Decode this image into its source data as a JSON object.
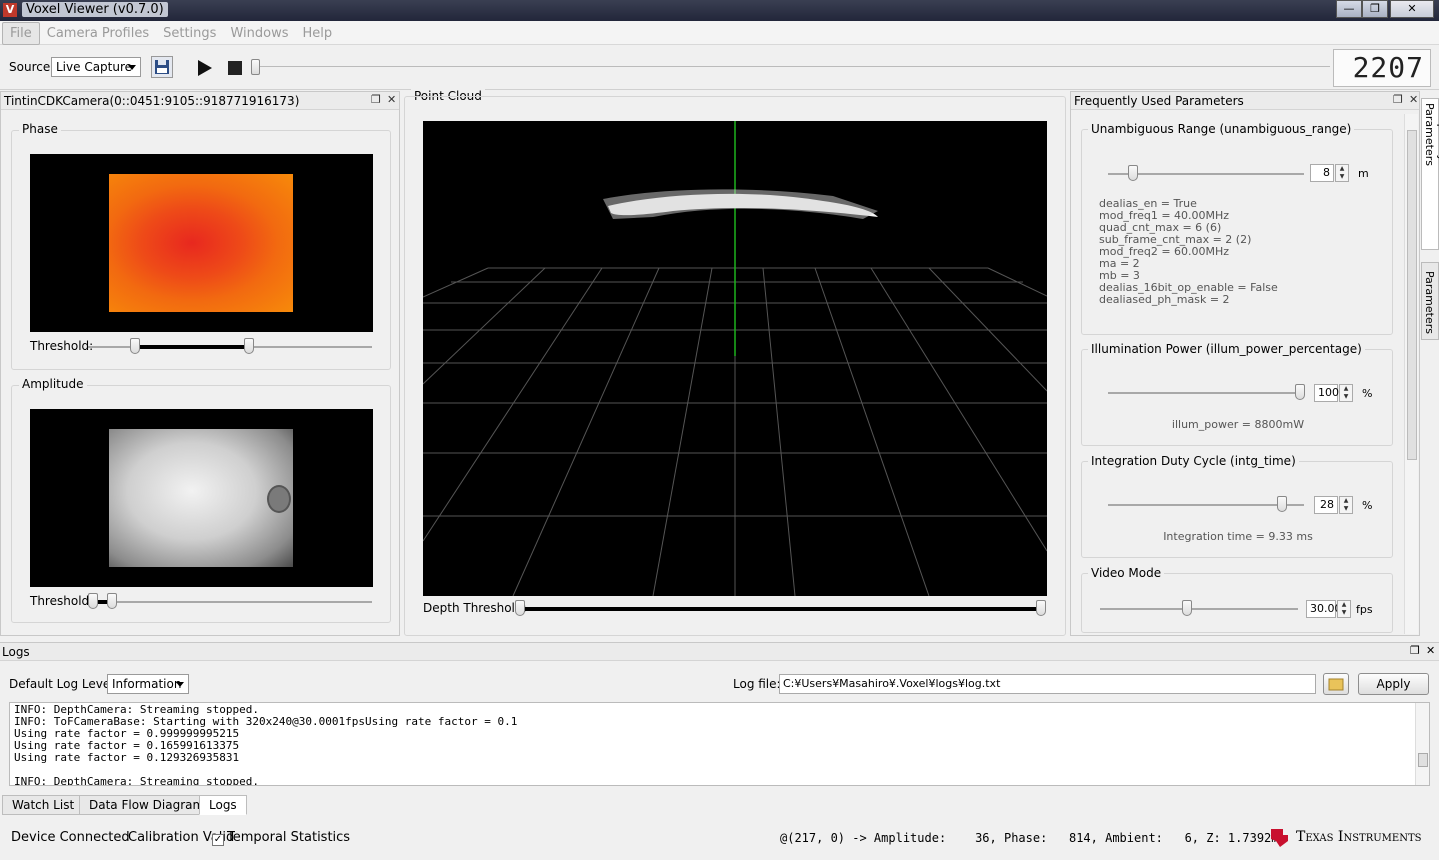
{
  "window": {
    "title": "Voxel Viewer (v0.7.0)",
    "app_icon": "V"
  },
  "menu": [
    "File",
    "Camera Profiles",
    "Settings",
    "Windows",
    "Help"
  ],
  "toolbar": {
    "source_label": "Source:",
    "source_value": "Live Capture",
    "frame_counter": "2207"
  },
  "camera_panel": {
    "title": "TintinCDKCamera(0::0451:9105::918771916173)",
    "phase": {
      "title": "Phase",
      "threshold_label": "Threshold:"
    },
    "amplitude": {
      "title": "Amplitude",
      "threshold_label": "Threshold:"
    }
  },
  "point_cloud": {
    "title": "Point Cloud",
    "depth_threshold_label": "Depth Threshold:"
  },
  "params_panel": {
    "title": "Frequently Used Parameters",
    "unambiguous": {
      "title": "Unambiguous Range (unambiguous_range)",
      "value": "8",
      "unit": "m",
      "details": [
        "dealias_en = True",
        "mod_freq1 = 40.00MHz",
        "quad_cnt_max = 6 (6)",
        "sub_frame_cnt_max = 2 (2)",
        "mod_freq2 = 60.00MHz",
        "ma = 2",
        "mb = 3",
        "dealias_16bit_op_enable = False",
        "dealiased_ph_mask = 2"
      ]
    },
    "illum": {
      "title": "Illumination Power (illum_power_percentage)",
      "value": "100",
      "unit": "%",
      "note": "illum_power = 8800mW"
    },
    "integration": {
      "title": "Integration Duty Cycle (intg_time)",
      "value": "28",
      "unit": "%",
      "note": "Integration time = 9.33 ms"
    },
    "video": {
      "title": "Video Mode",
      "value": "30.00",
      "unit": "fps"
    },
    "side_tabs": [
      "Frequently Used Parameters",
      "Parameters"
    ]
  },
  "logs": {
    "title": "Logs",
    "level_label": "Default Log Level:",
    "level_value": "Information",
    "file_label": "Log file:",
    "file_value": "C:¥Users¥Masahiro¥.Voxel¥logs¥log.txt",
    "apply_label": "Apply",
    "lines": [
      "INFO: DepthCamera: Streaming stopped.",
      "INFO: ToFCameraBase: Starting with 320x240@30.0001fpsUsing rate factor = 0.1",
      "Using rate factor = 0.999999995215",
      "Using rate factor = 0.165991613375",
      "Using rate factor = 0.129326935831",
      "",
      "INFO: DepthCamera: Streaming stopped."
    ]
  },
  "bottom_tabs": [
    "Watch List",
    "Data Flow Diagram",
    "Logs"
  ],
  "status": {
    "device": "Device Connected",
    "calibration": "Calibration Valid",
    "checkmark": "✓",
    "temporal": "Temporal Statistics",
    "readout": "@(217, 0) -> Amplitude:    36, Phase:   814, Ambient:   6, Z: 1.7392m",
    "brand": "Texas Instruments"
  }
}
